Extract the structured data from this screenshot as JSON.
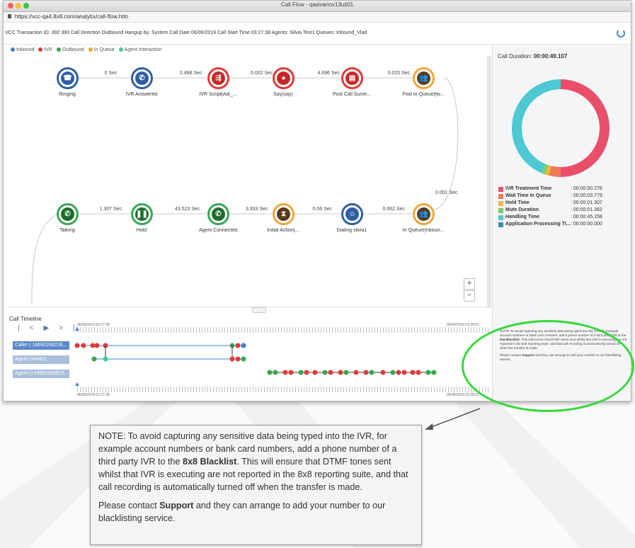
{
  "window": {
    "title": "Call Flow - qasivanov13uit01",
    "url": "https://vcc-qa4.8x8.com/analytix/call-flow.htm"
  },
  "infobar": {
    "text": "VCC Transaction ID: 392 393   Call Direction Outbound   Hangup by: System   Call Date 06/06/2019   Call Start Time 03:27:38   Agents: Silvia Test1   Queues: Inbound_Vlad"
  },
  "legend": [
    {
      "label": "Inbound",
      "color": "#3d7fd6"
    },
    {
      "label": "IVR",
      "color": "#e03a3a"
    },
    {
      "label": "Outbound",
      "color": "#37a84f"
    },
    {
      "label": "In Queue",
      "color": "#f2a53a"
    },
    {
      "label": "Agent Interaction",
      "color": "#46c79b"
    }
  ],
  "flow": {
    "row1_nodes": [
      {
        "label": "Ringing",
        "icon": "phone-icon",
        "color": "blue"
      },
      {
        "label": "IVR Answered",
        "icon": "phone-ring-icon",
        "color": "blue"
      },
      {
        "label": "IVR Script|Adi_...",
        "icon": "split-icon",
        "color": "red"
      },
      {
        "label": "Say(say)",
        "icon": "speech-icon",
        "color": "red"
      },
      {
        "label": "Post Call Surve...",
        "icon": "clipboard-icon",
        "color": "red"
      },
      {
        "label": "Fwd to Queue(fw...",
        "icon": "people-icon",
        "color": "orange"
      }
    ],
    "row1_edges": [
      "0 Sec",
      "0.488 Sec",
      "0.002 Sec",
      "4.696 Sec",
      "0.015 Sec"
    ],
    "vertical_edge": "0.001 Sec",
    "row2_nodes": [
      {
        "label": "Talking",
        "icon": "phone-ring-icon",
        "color": "green"
      },
      {
        "label": "Hold",
        "icon": "pause-icon",
        "color": "green"
      },
      {
        "label": "Agent Connected",
        "icon": "phone-ring-icon",
        "color": "green"
      },
      {
        "label": "Initial Action(...",
        "icon": "hourglass-icon",
        "color": "orange"
      },
      {
        "label": "Dialing silvia1",
        "icon": "agent-icon",
        "color": "blue"
      },
      {
        "label": "In Queue(Inboun...",
        "icon": "people-icon",
        "color": "orange"
      }
    ],
    "row2_edges": [
      "1.307 Sec",
      "43.523 Sec",
      "3.933 Sec",
      "0.06 Sec",
      "0.062 Sec"
    ],
    "zoom_in": "+",
    "zoom_out": "−"
  },
  "timeline": {
    "title": "Call Timeline",
    "controls": [
      "|<",
      "▶",
      ">|"
    ],
    "start_time_top": "06/06/2019 02:27:38",
    "end_time_top": "06/06/2019 02:28:51",
    "start_time_bottom": "06/06/2019 02:27:38",
    "end_time_bottom": "06/06/2019 02:28:51",
    "rows": [
      "Caller ( 16692266228...",
      "Agent (silvia1)",
      "Agent (+16692266622..."
    ]
  },
  "panel": {
    "duration_label": "Call Duration:",
    "duration_value": "00:00:49.107",
    "stats": [
      {
        "label": "IVR Treatment Time",
        "value": ": 00:00:50.278",
        "color": "#e8506a"
      },
      {
        "label": "Wait Time In Queue",
        "value": ": 00:00:03.779",
        "color": "#f07a52"
      },
      {
        "label": "Hold Time",
        "value": ": 00:00:01.307",
        "color": "#f2b441"
      },
      {
        "label": "Mute Duration",
        "value": ": 00:00:01.362",
        "color": "#7ccf6b"
      },
      {
        "label": "Handling Time",
        "value": ": 00:00:45.158",
        "color": "#4ec9d3"
      },
      {
        "label": "Application Processing Ti...",
        "value": ": 00:00:00.000",
        "color": "#3b8fb3"
      }
    ],
    "donut": [
      {
        "name": "IVR Treatment Time",
        "fraction": 0.5,
        "color": "#e8506a"
      },
      {
        "name": "Wait Time In Queue",
        "fraction": 0.038,
        "color": "#f07a52"
      },
      {
        "name": "Hold Time",
        "fraction": 0.013,
        "color": "#f2b441"
      },
      {
        "name": "Mute Duration",
        "fraction": 0.013,
        "color": "#7ccf6b"
      },
      {
        "name": "Handling Time",
        "fraction": 0.436,
        "color": "#4ec9d3"
      }
    ]
  },
  "note": {
    "p1_a": "NOTE: To avoid capturing any sensitive data being typed into the IVR, for example account numbers or bank card numbers, add a phone number of a third party IVR to the ",
    "p1_bold": "8x8 Blacklist",
    "p1_b": ". This will ensure that DTMF tones sent whilst that IVR is executing are not reported in the 8x8 reporting suite, and that call recording is automatically turned off when the transfer is made.",
    "p2_a": "Please contact ",
    "p2_bold": "Support",
    "p2_b": " and they can arrange to add your number to our blacklisting service."
  }
}
